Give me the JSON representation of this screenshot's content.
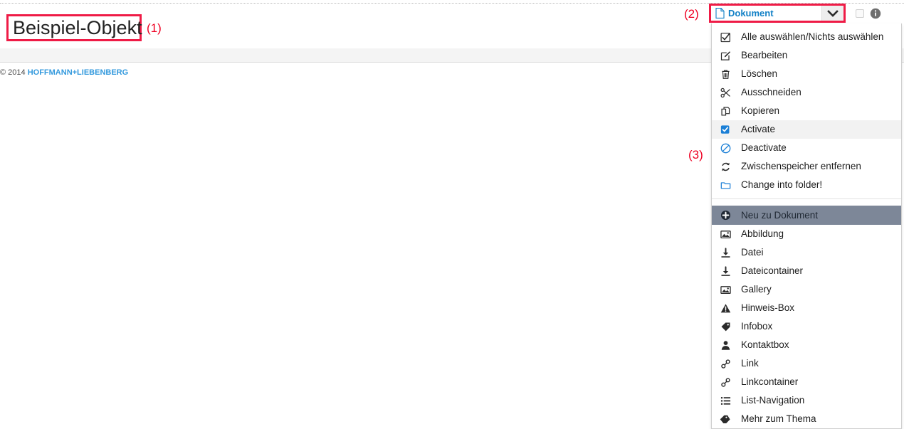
{
  "page": {
    "title": "Beispiel-Objekt",
    "copyright_mark": "© 2014",
    "copyright_brand": "HOFFMANN+LIEBENBERG"
  },
  "callouts": {
    "one": "(1)",
    "two": "(2)",
    "three": "(3)"
  },
  "dropdown_button": {
    "label": "Dokument",
    "icon": "document-icon",
    "toggle_icon": "chevron-down-icon"
  },
  "top_right": {
    "checkbox_icon": "checkbox-unchecked-icon",
    "info_icon": "info-circle-icon"
  },
  "menu": {
    "actions": [
      {
        "label": "Alle auswählen/Nichts auswählen",
        "icon": "check-square-icon",
        "selected": false
      },
      {
        "label": "Bearbeiten",
        "icon": "edit-pencil-square-icon",
        "selected": false
      },
      {
        "label": "Löschen",
        "icon": "trash-icon",
        "selected": false
      },
      {
        "label": "Ausschneiden",
        "icon": "scissors-icon",
        "selected": false
      },
      {
        "label": "Kopieren",
        "icon": "copy-icon",
        "selected": false
      },
      {
        "label": "Activate",
        "icon": "checkbox-checked-blue-icon",
        "selected": true
      },
      {
        "label": "Deactivate",
        "icon": "circle-slash-icon",
        "selected": false
      },
      {
        "label": "Zwischenspeicher entfernen",
        "icon": "refresh-icon",
        "selected": false
      },
      {
        "label": "Change into folder!",
        "icon": "folder-icon",
        "selected": false
      }
    ],
    "new_section_header": {
      "label": "Neu zu Dokument",
      "icon": "plus-circle-icon"
    },
    "new_items": [
      {
        "label": "Abbildung",
        "icon": "image-icon"
      },
      {
        "label": "Datei",
        "icon": "download-file-icon"
      },
      {
        "label": "Dateicontainer",
        "icon": "download-file-icon"
      },
      {
        "label": "Gallery",
        "icon": "image-icon"
      },
      {
        "label": "Hinweis-Box",
        "icon": "warning-triangle-icon"
      },
      {
        "label": "Infobox",
        "icon": "tag-icon"
      },
      {
        "label": "Kontaktbox",
        "icon": "person-icon"
      },
      {
        "label": "Link",
        "icon": "link-chain-icon"
      },
      {
        "label": "Linkcontainer",
        "icon": "link-chain-icon"
      },
      {
        "label": "List-Navigation",
        "icon": "list-icon"
      },
      {
        "label": "Mehr zum Thema",
        "icon": "tag-filled-icon"
      }
    ]
  },
  "colors": {
    "annotation_red": "#ef1b46",
    "callout_red": "#ee0022",
    "link_blue": "#1180c6",
    "brand_blue": "#3399dd",
    "section_header_bg": "#7d8798",
    "selected_row_bg": "#f2f2f2"
  }
}
